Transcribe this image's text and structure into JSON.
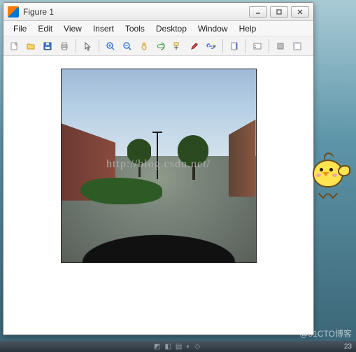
{
  "window": {
    "title": "Figure 1"
  },
  "menu": {
    "file": "File",
    "edit": "Edit",
    "view": "View",
    "insert": "Insert",
    "tools": "Tools",
    "desktop": "Desktop",
    "window": "Window",
    "help": "Help"
  },
  "toolbar_icons": {
    "new": "new-file-icon",
    "open": "open-folder-icon",
    "save": "save-icon",
    "print": "print-icon",
    "pointer": "pointer-icon",
    "zoom_in": "zoom-in-icon",
    "zoom_out": "zoom-out-icon",
    "pan": "pan-icon",
    "rotate": "rotate-3d-icon",
    "data_cursor": "data-cursor-icon",
    "brush": "brush-icon",
    "link": "link-plot-icon",
    "colorbar": "insert-colorbar-icon",
    "legend": "insert-legend-icon",
    "hide_tools": "hide-plot-tools-icon",
    "show_tools": "show-plot-tools-icon"
  },
  "watermark": "http://blog.csdn.net/",
  "footer_watermark": "@51CTO博客",
  "taskbar": {
    "time": "23"
  }
}
